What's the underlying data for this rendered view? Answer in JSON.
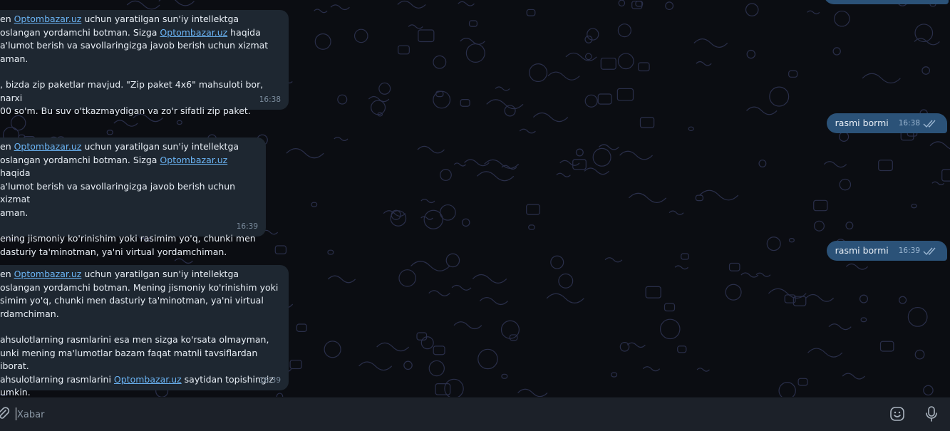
{
  "incoming": [
    {
      "prefix1": "en ",
      "link1": "Optombazar.uz",
      "mid1": " uchun yaratilgan sun'iy intellektga\noslangan yordamchi botman. Sizga ",
      "link2": "Optombazar.uz",
      "tail1": " haqida\na'lumot berish va savollaringizga javob berish uchun xizmat\naman.",
      "body": ", bizda zip paketlar mavjud. \"Zip paket 4x6\" mahsuloti bor, narxi\n00 so'm. Bu suv o'tkazmaydigan va zo'r sifatli zip paket.",
      "time": "16:38"
    },
    {
      "prefix1": "en ",
      "link1": "Optombazar.uz",
      "mid1": " uchun yaratilgan sun'iy intellektga\noslangan yordamchi botman. Sizga ",
      "link2": "Optombazar.uz",
      "tail1": " haqida\na'lumot berish va savollaringizga javob berish uchun xizmat\naman.",
      "body": "ening jismoniy ko'rinishim yoki rasimim yo'q, chunki men\ndasturiy ta'minotman, ya'ni virtual yordamchiman.",
      "time": "16:39"
    },
    {
      "prefix1": "en ",
      "link1": "Optombazar.uz",
      "tail1": " uchun yaratilgan sun'iy intellektga\noslangan yordamchi botman. Mening jismoniy ko'rinishim yoki\nsimim yo'q, chunki men dasturiy ta'minotman, ya'ni virtual\nrdamchiman.",
      "body1": "ahsulotlarning rasmlarini esa men sizga ko'rsata olmayman,\nunki mening ma'lumotlar bazam faqat matnli tavsiflardan iborat.\nahsulotlarning rasmlarini ",
      "link2": "Optombazar.uz",
      "body2": " saytidan topishingiz\numkin.",
      "time": "16:39"
    }
  ],
  "outgoing": [
    {
      "text": "rasmi bormi",
      "time": "16:38"
    },
    {
      "text": "rasmi bormi",
      "time": "16:39"
    }
  ],
  "composer": {
    "placeholder": "Xabar"
  },
  "icons": [
    "attach-icon",
    "emoji-icon",
    "microphone-icon",
    "double-check-icon"
  ],
  "colors": {
    "incoming": "#1e2731",
    "outgoing": "#2b5278",
    "link": "#6ab3f3",
    "background": "#0b0d12"
  }
}
